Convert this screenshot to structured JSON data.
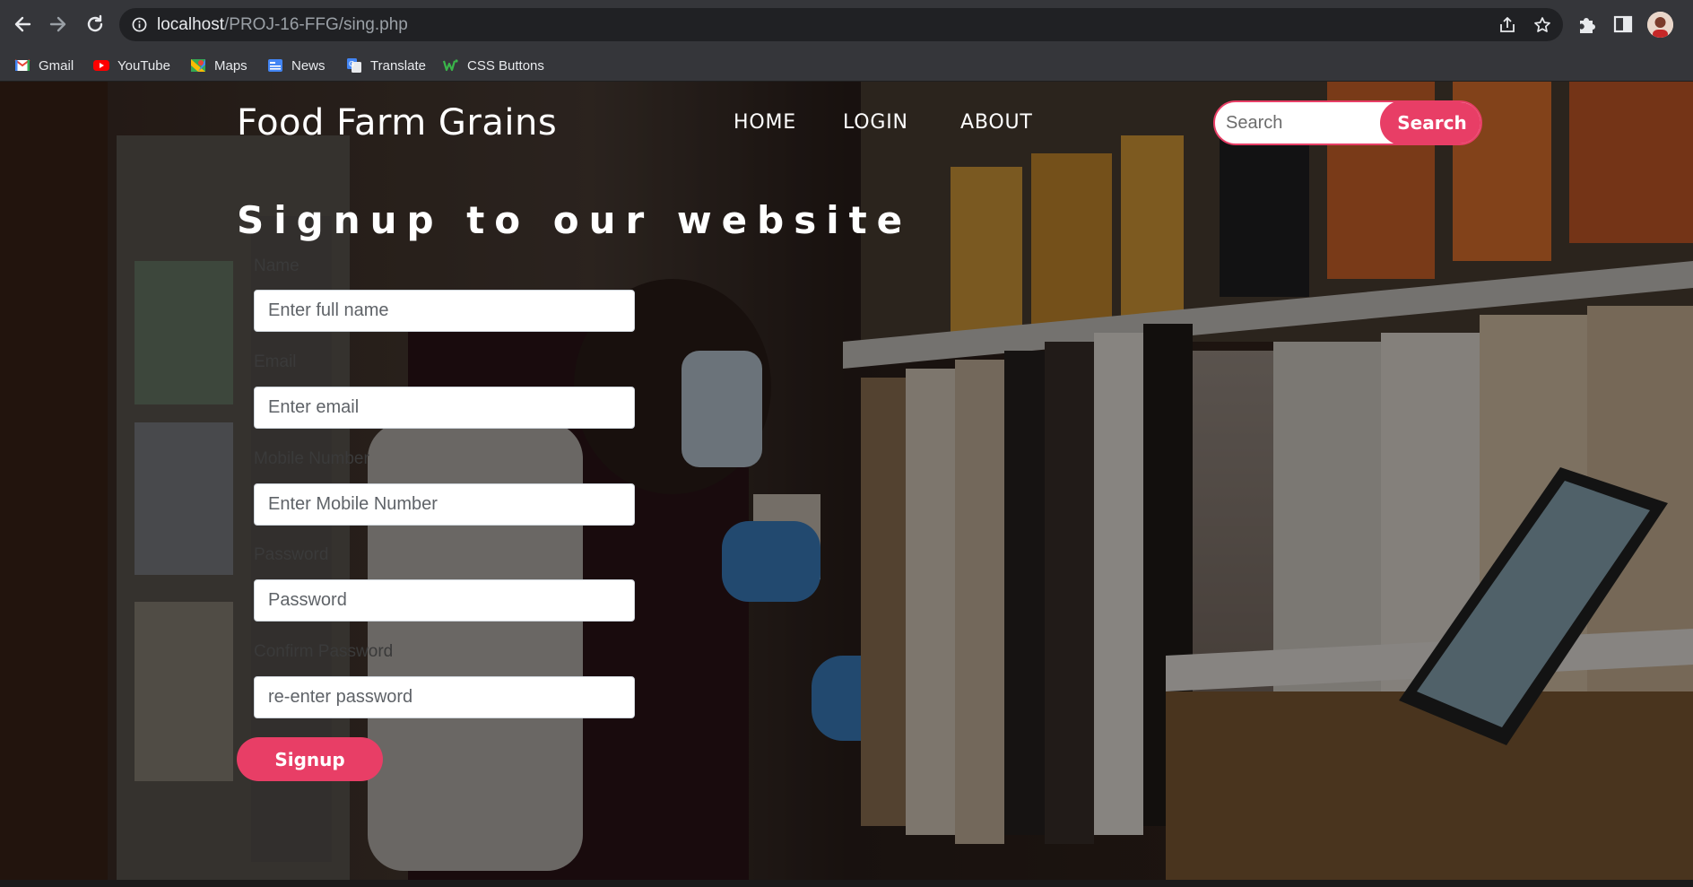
{
  "browser": {
    "url_host": "localhost",
    "url_path": "/PROJ-16-FFG/sing.php",
    "bookmarks": [
      {
        "label": "Gmail",
        "icon": "gmail-icon"
      },
      {
        "label": "YouTube",
        "icon": "youtube-icon"
      },
      {
        "label": "Maps",
        "icon": "maps-icon"
      },
      {
        "label": "News",
        "icon": "news-icon"
      },
      {
        "label": "Translate",
        "icon": "translate-icon"
      },
      {
        "label": "CSS Buttons",
        "icon": "css-buttons-icon"
      }
    ]
  },
  "site": {
    "brand": "Food Farm Grains",
    "nav": {
      "home": "HOME",
      "login": "LOGIN",
      "about": "ABOUT"
    },
    "search": {
      "placeholder": "Search",
      "button": "Search"
    }
  },
  "form": {
    "heading": "Signup to our website",
    "fields": [
      {
        "label": "Name",
        "placeholder": "Enter full name"
      },
      {
        "label": "Email",
        "placeholder": "Enter email"
      },
      {
        "label": "Mobile Number",
        "placeholder": "Enter Mobile Number"
      },
      {
        "label": "Password",
        "placeholder": "Password"
      },
      {
        "label": "Confirm Password",
        "placeholder": "re-enter password"
      }
    ],
    "submit": "Signup"
  },
  "colors": {
    "accent": "#e83e66",
    "chrome": "#35363a",
    "omnibox": "#202124"
  }
}
